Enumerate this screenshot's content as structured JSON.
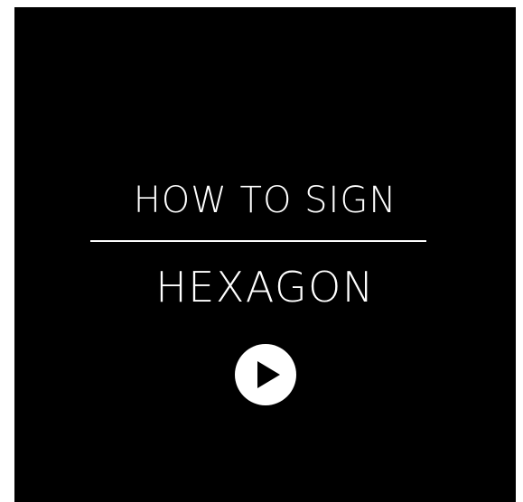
{
  "video": {
    "title_line1": "HOW TO SIGN",
    "title_line2": "HEXAGON",
    "play_icon": "play-icon",
    "colors": {
      "background": "#000000",
      "foreground": "#ffffff"
    }
  }
}
